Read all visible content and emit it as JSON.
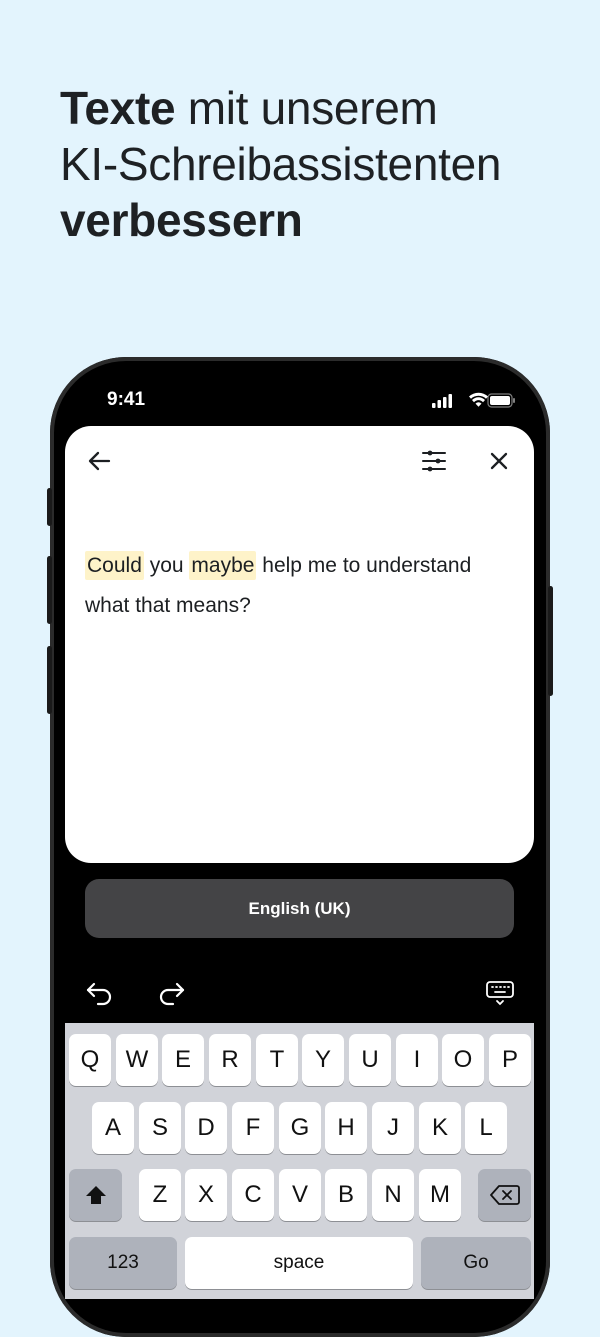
{
  "headline": {
    "line1_bold": "Texte",
    "line1_rest": " mit unserem",
    "line2": "KI-Schreibassistenten",
    "line3_bold": "verbessern"
  },
  "status_bar": {
    "time": "9:41"
  },
  "editor": {
    "highlight_1": "Could",
    "text_1": " you ",
    "highlight_2": "maybe",
    "text_2": " help me to understand what that means?"
  },
  "language_button": {
    "label": "English (UK)"
  },
  "keyboard": {
    "row1": [
      "Q",
      "W",
      "E",
      "R",
      "T",
      "Y",
      "U",
      "I",
      "O",
      "P"
    ],
    "row2": [
      "A",
      "S",
      "D",
      "F",
      "G",
      "H",
      "J",
      "K",
      "L"
    ],
    "row3": [
      "Z",
      "X",
      "C",
      "V",
      "B",
      "N",
      "M"
    ],
    "numbers_label": "123",
    "space_label": "space",
    "go_label": "Go"
  },
  "colors": {
    "background": "#e3f4fd",
    "highlight": "#fef3c9",
    "language_bar": "#444446"
  }
}
